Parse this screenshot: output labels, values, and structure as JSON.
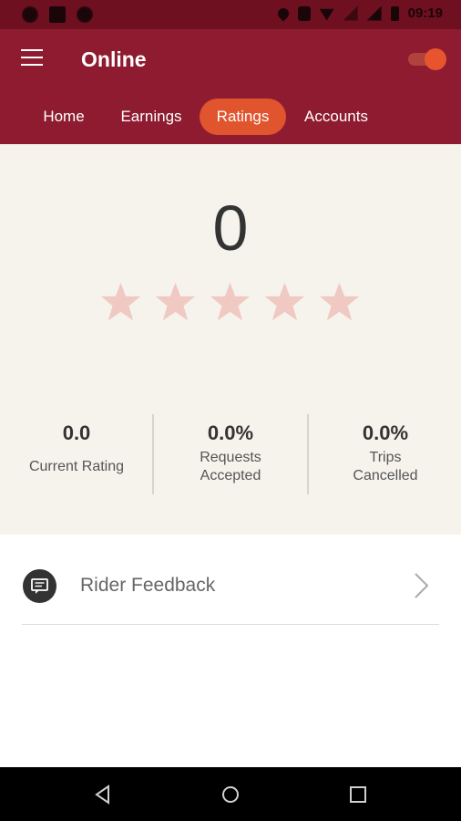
{
  "status_bar": {
    "time": "09:19",
    "icons": [
      "target-icon",
      "image-icon",
      "sync-icon",
      "location-pin-icon",
      "vibrate-icon",
      "wifi-icon",
      "no-signal-icon",
      "signal-icon",
      "battery-icon"
    ]
  },
  "app_bar": {
    "title": "Online",
    "online_toggle": true
  },
  "tabs": [
    {
      "label": "Home",
      "active": false
    },
    {
      "label": "Earnings",
      "active": false
    },
    {
      "label": "Ratings",
      "active": true
    },
    {
      "label": "Accounts",
      "active": false
    }
  ],
  "rating": {
    "value": "0",
    "stars_filled": 0,
    "stars_total": 5
  },
  "stats": [
    {
      "value": "0.0",
      "label": "Current Rating"
    },
    {
      "value": "0.0%",
      "label": "Requests Accepted"
    },
    {
      "value": "0.0%",
      "label": "Trips Cancelled"
    }
  ],
  "feedback": {
    "label": "Rider Feedback"
  },
  "colors": {
    "primary": "#8e1b2f",
    "accent": "#e0542e",
    "star_empty": "#efc9c2",
    "panel": "#f5f3ec"
  }
}
